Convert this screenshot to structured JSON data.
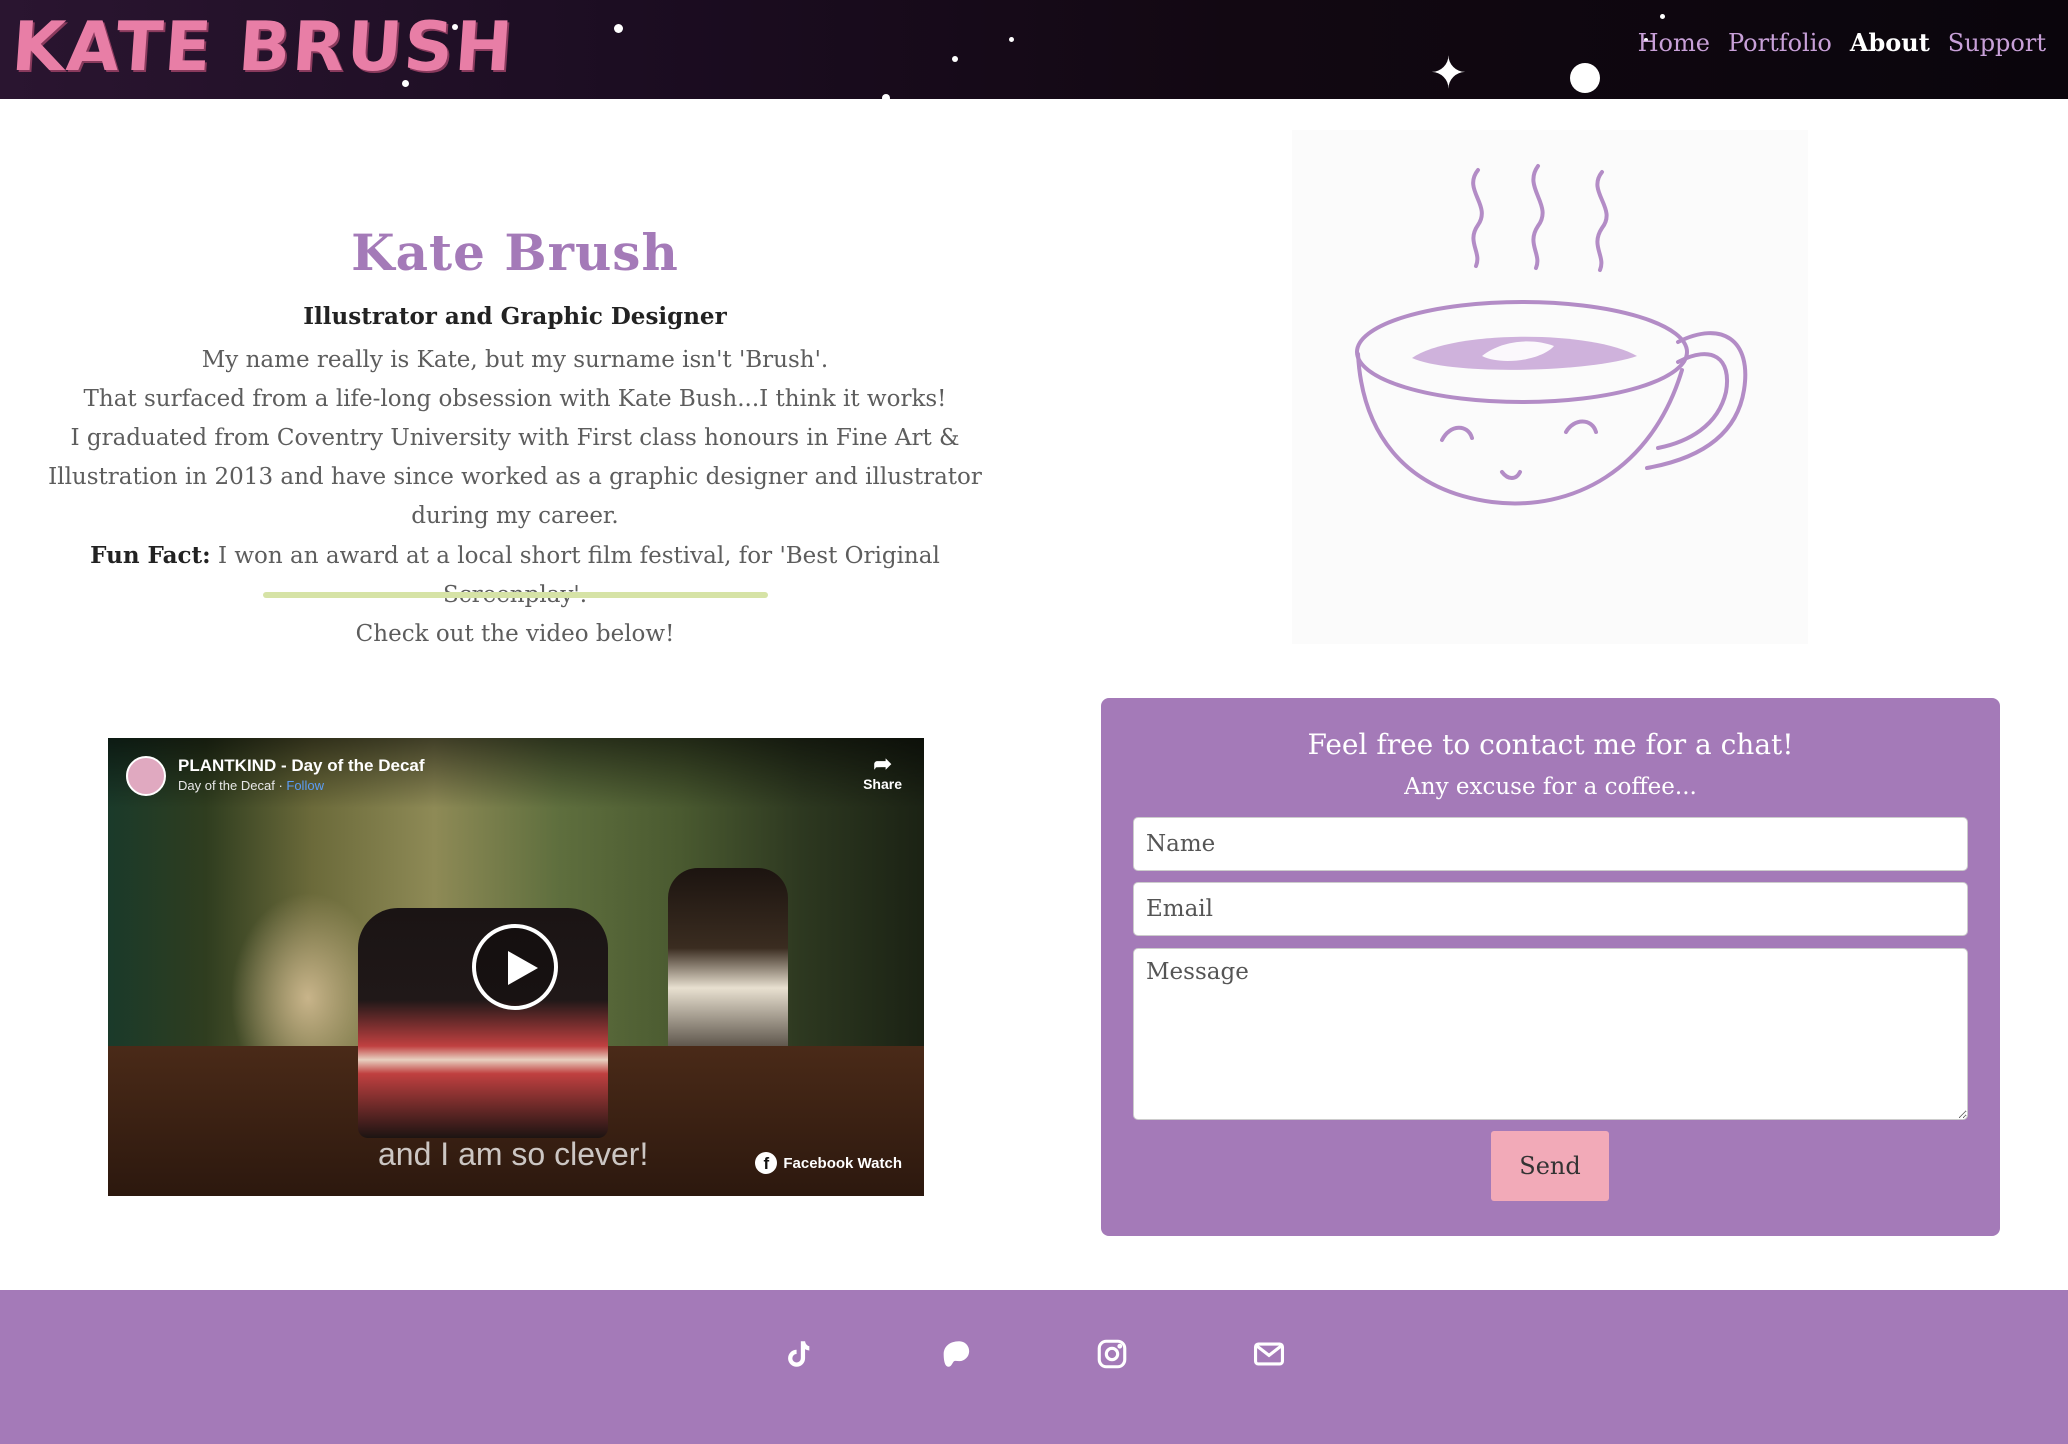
{
  "header": {
    "logo_text": "KATE BRUSH",
    "nav": [
      {
        "label": "Home",
        "active": false
      },
      {
        "label": "Portfolio",
        "active": false
      },
      {
        "label": "About",
        "active": true
      },
      {
        "label": "Support",
        "active": false
      }
    ]
  },
  "about": {
    "title": "Kate Brush",
    "subtitle": "Illustrator and Graphic Designer",
    "line1": "My name really is Kate, but my surname isn't 'Brush'.",
    "line2": "That surfaced from a life-long obsession with Kate Bush...I think it works!",
    "line3": "I graduated from Coventry University with First class honours in Fine Art & Illustration in 2013 and have since worked as a graphic designer and illustrator during my career.",
    "fun_fact_label": "Fun Fact:",
    "fun_fact_text": " I won an award at a local short film festival, for 'Best Original Screenplay'.",
    "line5": "Check out the video below!"
  },
  "video": {
    "title": "PLANTKIND - Day of the Decaf",
    "channel": "Day of the Decaf",
    "separator": " · ",
    "follow": "Follow",
    "share": "Share",
    "caption": "and I am so clever!",
    "watch_label": "Facebook Watch"
  },
  "contact": {
    "heading": "Feel free to contact me for a chat!",
    "subheading": "Any excuse for a coffee...",
    "name_placeholder": "Name",
    "email_placeholder": "Email",
    "message_placeholder": "Message",
    "send_label": "Send"
  },
  "footer": {
    "icons": [
      "tiktok-icon",
      "patreon-icon",
      "instagram-icon",
      "email-icon"
    ]
  },
  "colors": {
    "brand_purple": "#a47ab8",
    "accent_pink": "#f2aab8",
    "logo_pink": "#e87ea6",
    "rule_green": "#d6e3a6"
  }
}
